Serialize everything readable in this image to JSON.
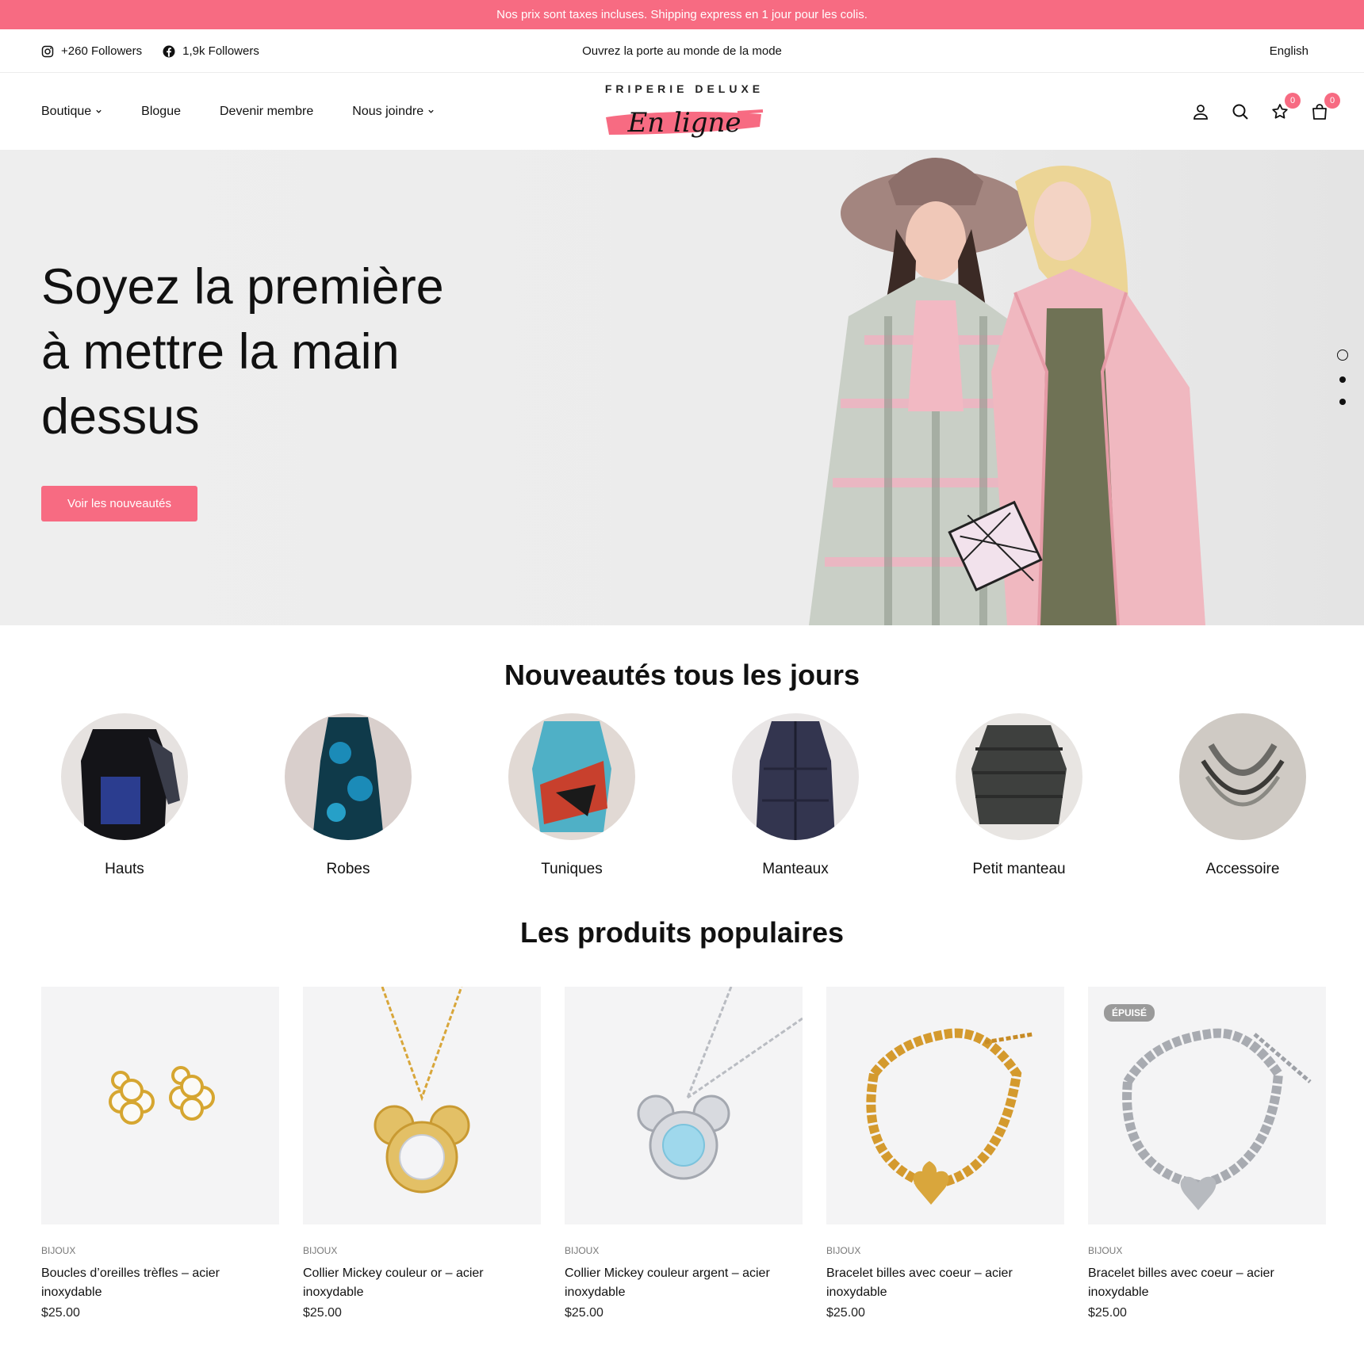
{
  "announcement": "Nos prix sont taxes incluses. Shipping express en 1 jour pour les colis.",
  "topbar": {
    "instagram_followers": "+260 Followers",
    "facebook_followers": "1,9k Followers",
    "tagline": "Ouvrez la porte au monde de la mode",
    "language": "English"
  },
  "nav": {
    "items": [
      {
        "label": "Boutique",
        "has_dropdown": true
      },
      {
        "label": "Blogue",
        "has_dropdown": false
      },
      {
        "label": "Devenir membre",
        "has_dropdown": false
      },
      {
        "label": "Nous joindre",
        "has_dropdown": true
      }
    ]
  },
  "logo": {
    "top_text": "FRIPERIE DELUXE",
    "script_text": "En ligne"
  },
  "header_icons": {
    "account": "user-icon",
    "search": "search-icon",
    "wishlist": "star-icon",
    "wishlist_count": "0",
    "cart": "bag-icon",
    "cart_count": "0"
  },
  "hero": {
    "title": "Soyez la première à mettre la main dessus",
    "button": "Voir les nouveautés",
    "slides": 3,
    "active_slide": 1
  },
  "categories": {
    "title": "Nouveautés tous les jours",
    "items": [
      "Hauts",
      "Robes",
      "Tuniques",
      "Manteaux",
      "Petit manteau",
      "Accessoire"
    ]
  },
  "popular": {
    "title": "Les produits populaires",
    "items": [
      {
        "category": "BIJOUX",
        "name": "Boucles d’oreilles trèfles – acier inoxydable",
        "price": "$25.00",
        "badge": ""
      },
      {
        "category": "BIJOUX",
        "name": "Collier Mickey couleur or – acier inoxydable",
        "price": "$25.00",
        "badge": ""
      },
      {
        "category": "BIJOUX",
        "name": "Collier Mickey couleur argent – acier inoxydable",
        "price": "$25.00",
        "badge": ""
      },
      {
        "category": "BIJOUX",
        "name": "Bracelet billes avec coeur – acier inoxydable",
        "price": "$25.00",
        "badge": ""
      },
      {
        "category": "BIJOUX",
        "name": "Bracelet billes avec coeur – acier inoxydable",
        "price": "$25.00",
        "badge": "ÉPUISÉ"
      }
    ]
  },
  "colors": {
    "accent": "#f76b82",
    "text": "#111111",
    "hero_bg": "#ececec"
  }
}
